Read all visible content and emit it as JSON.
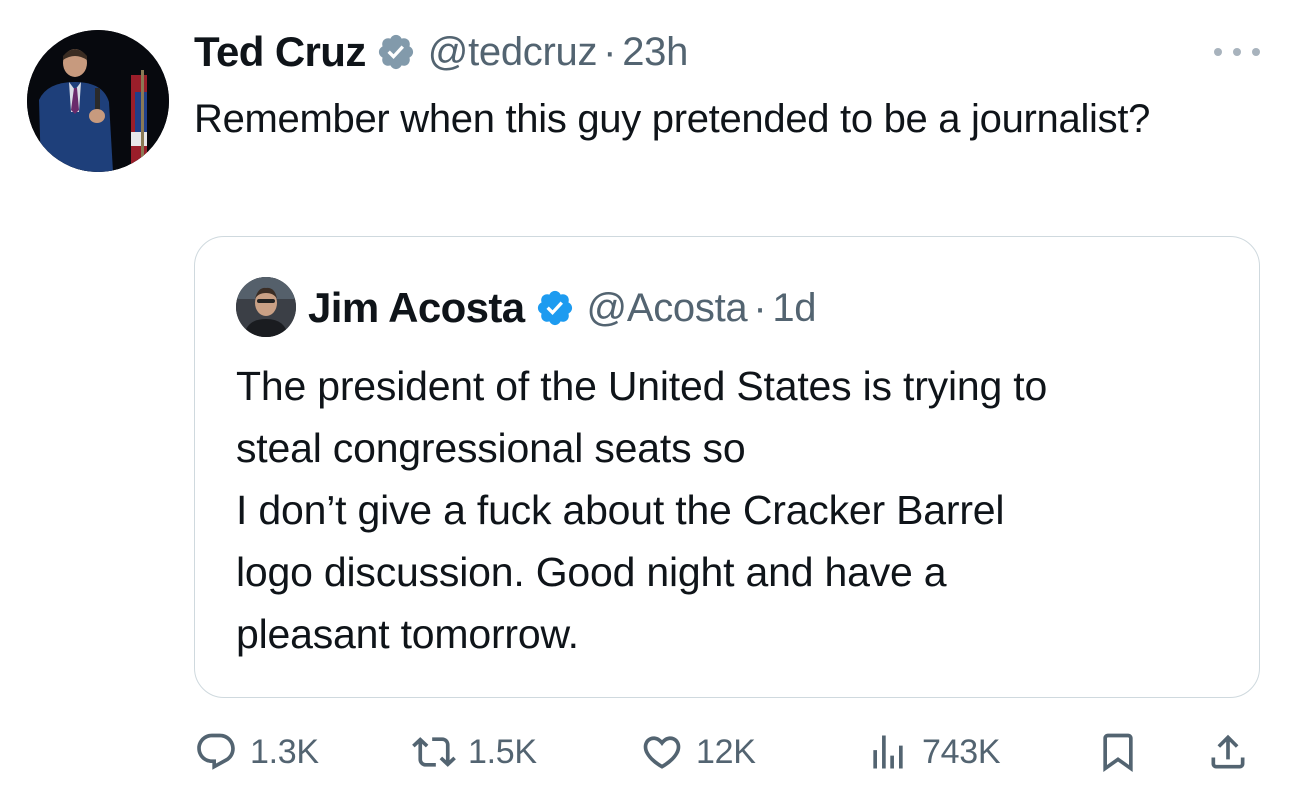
{
  "tweet": {
    "author_name": "Ted Cruz",
    "handle": "@tedcruz",
    "separator": "·",
    "time": "23h",
    "text": "Remember when this guy pretended to be a journalist?"
  },
  "quoted_tweet": {
    "author_name": "Jim Acosta",
    "handle": "@Acosta",
    "separator": "·",
    "time": "1d",
    "text_lines": [
      "The president of the United States is trying to",
      "steal congressional seats so",
      "I don’t give a fuck about the Cracker Barrel",
      "logo discussion. Good night and have a",
      "pleasant tomorrow."
    ]
  },
  "actions": {
    "replies": "1.3K",
    "reposts": "1.5K",
    "likes": "12K",
    "views": "743K"
  },
  "colors": {
    "verified": "#1d9bf0",
    "verified_government": "#829aab",
    "text_primary": "#0f1419",
    "text_secondary": "#536471",
    "border": "#cfd9de"
  },
  "icons": {
    "verified_gov": "verified-badge-gray-icon",
    "verified": "verified-badge-blue-icon",
    "more": "more-horizontal-icon",
    "reply": "reply-bubble-icon",
    "repost": "repost-arrows-icon",
    "like": "heart-icon",
    "views": "bar-chart-icon",
    "bookmark": "bookmark-icon",
    "share": "share-upload-icon"
  }
}
